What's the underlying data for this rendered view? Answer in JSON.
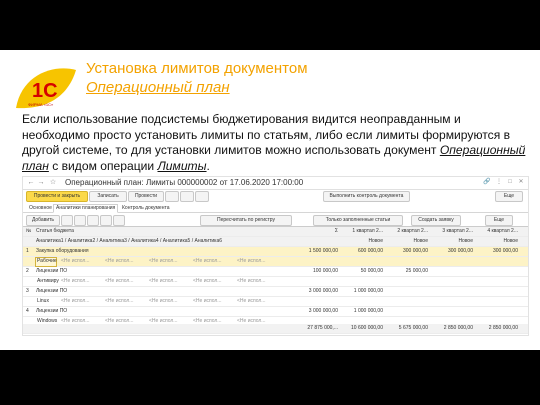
{
  "slide": {
    "title_line1": "Установка лимитов документом",
    "title_line2": "Операционный план",
    "logo": {
      "icon": "1c-logo",
      "text": "1C",
      "subtext": "ФИРМА «1С»"
    },
    "desc_part1": "Если использование подсистемы бюджетирования видится неоправданным и необходимо просто установить лимиты по статьям, либо если лимиты формируются в другой системе, то для установки лимитов можно использовать документ ",
    "desc_em1": "Операционный план",
    "desc_part2": " с видом операции ",
    "desc_em2": "Лимиты",
    "desc_part3": "."
  },
  "window": {
    "title": "Операционный план: Лимиты 000000002 от 17.06.2020 17:00:00",
    "nav_back": "←",
    "nav_forward": "→",
    "star": "☆"
  },
  "toolbar": {
    "post_close": "Провести и закрыть",
    "save": "Записать",
    "post": "Провести",
    "btn4": "",
    "btn5": "",
    "btn6": "",
    "check_limits": "Выполнить контроль документа",
    "more": "Еще"
  },
  "tabs": [
    "Основное",
    "Аналитики планирования",
    "Контроль документа"
  ],
  "grid_toolbar": {
    "add": "Добавить",
    "copy_mark": "",
    "btn_c": "",
    "btn_d": "",
    "btn_e": "",
    "btn_f": "",
    "fill_register": "Пересчитать по регистру",
    "filter_only": "Только заполненные статьи",
    "create_request": "Создать заявку",
    "more": "Еще"
  },
  "table": {
    "headers": {
      "n": "№",
      "article": "Статья бюджета",
      "analytics": "Аналитика1 / Аналитика2 / Аналитика3 / Аналитика4 / Аналитика5 / Аналитика6",
      "sum": "Σ",
      "q1": "1 квартал 2...",
      "q2": "2 квартал 2...",
      "q3": "3 квартал 2...",
      "q4": "4 квартал 2..."
    },
    "subheaders": {
      "q1": "Новое",
      "q2": "Новое",
      "q3": "Новое",
      "q4": "Новое"
    },
    "rows": [
      {
        "n": "1",
        "article": "Закупка оборудования",
        "sum": "1 500 000,00",
        "q1": "600 000,00",
        "q2": "300 000,00",
        "q3": "300 000,00",
        "q4": "300 000,00"
      },
      {
        "n": "",
        "article": "Рабочие с...",
        "a1": "<Не испол...",
        "a2": "<Не испол...",
        "a3": "<Не испол...",
        "a4": "<Не испол...",
        "a5": "<Не испол...",
        "sum": "",
        "q1": "",
        "q2": "",
        "q3": "",
        "q4": ""
      },
      {
        "n": "2",
        "article": "Лицензии ПО",
        "sum": "100 000,00",
        "q1": "50 000,00",
        "q2": "25 000,00",
        "q3": "",
        "q4": ""
      },
      {
        "n": "",
        "article": "Антивирус",
        "a1": "<Не испол...",
        "a2": "<Не испол...",
        "a3": "<Не испол...",
        "a4": "<Не испол...",
        "a5": "<Не испол...",
        "sum": "",
        "q1": "",
        "q2": "",
        "q3": "",
        "q4": ""
      },
      {
        "n": "3",
        "article": "Лицензии ПО",
        "sum": "3 000 000,00",
        "q1": "1 000 000,00",
        "q2": "",
        "q3": "",
        "q4": ""
      },
      {
        "n": "",
        "article": "Linux",
        "a1": "<Не испол...",
        "a2": "<Не испол...",
        "a3": "<Не испол...",
        "a4": "<Не испол...",
        "a5": "<Не испол...",
        "sum": "",
        "q1": "",
        "q2": "",
        "q3": "",
        "q4": ""
      },
      {
        "n": "4",
        "article": "Лицензии ПО",
        "sum": "3 000 000,00",
        "q1": "1 000 000,00",
        "q2": "",
        "q3": "",
        "q4": ""
      },
      {
        "n": "",
        "article": "Windows",
        "a1": "<Не испол...",
        "a2": "<Не испол...",
        "a3": "<Не испол...",
        "a4": "<Не испол...",
        "a5": "<Не испол...",
        "sum": "",
        "q1": "",
        "q2": "",
        "q3": "",
        "q4": ""
      }
    ],
    "totals": {
      "sum": "27 875 000,...",
      "q1": "10 600 000,00",
      "q2": "5 675 000,00",
      "q3": "2 850 000,00",
      "q4": "2 850 000,00"
    }
  },
  "colors": {
    "accent": "#f3a200",
    "primary_button": "#fbd94a",
    "selected_row": "#fdf3c6"
  }
}
